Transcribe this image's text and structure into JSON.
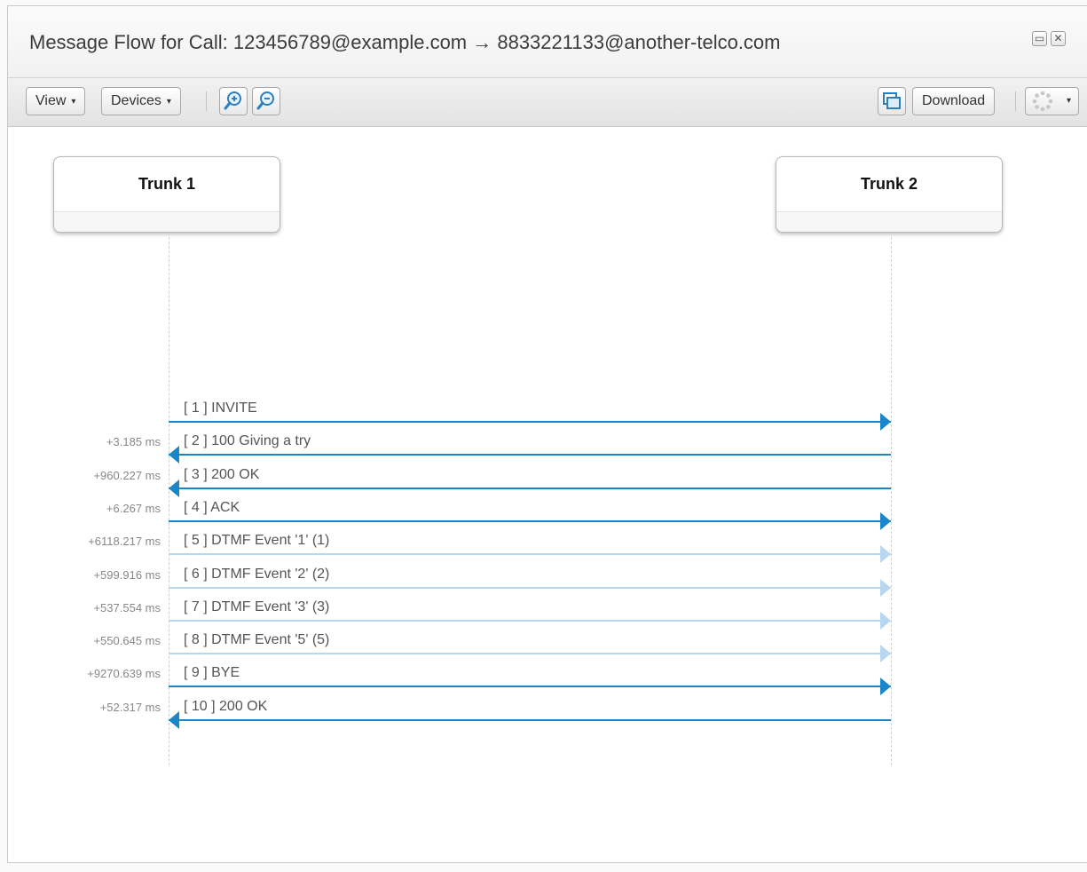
{
  "window": {
    "title": "Message Flow for Call: 123456789@example.com → 8833221133@another-telco.com",
    "maximize_icon": "▭",
    "close_icon": "✕"
  },
  "toolbar": {
    "view_label": "View",
    "devices_label": "Devices",
    "download_label": "Download",
    "caret": "▾"
  },
  "devices": [
    {
      "name": "Trunk 1"
    },
    {
      "name": "Trunk 2"
    }
  ],
  "messages": [
    {
      "label": "[ 1 ] INVITE",
      "delta": "",
      "direction": "right",
      "style": "normal"
    },
    {
      "label": "[ 2 ] 100 Giving a try",
      "delta": "+3.185 ms",
      "direction": "left",
      "style": "normal"
    },
    {
      "label": "[ 3 ] 200 OK",
      "delta": "+960.227 ms",
      "direction": "left",
      "style": "normal"
    },
    {
      "label": "[ 4 ] ACK",
      "delta": "+6.267 ms",
      "direction": "right",
      "style": "normal"
    },
    {
      "label": "[ 5 ] DTMF Event '1' (1)",
      "delta": "+6118.217 ms",
      "direction": "right",
      "style": "faded"
    },
    {
      "label": "[ 6 ] DTMF Event '2' (2)",
      "delta": "+599.916 ms",
      "direction": "right",
      "style": "faded"
    },
    {
      "label": "[ 7 ] DTMF Event '3' (3)",
      "delta": "+537.554 ms",
      "direction": "right",
      "style": "faded"
    },
    {
      "label": "[ 8 ] DTMF Event '5' (5)",
      "delta": "+550.645 ms",
      "direction": "right",
      "style": "faded"
    },
    {
      "label": "[ 9 ] BYE",
      "delta": "+9270.639 ms",
      "direction": "right",
      "style": "normal"
    },
    {
      "label": "[ 10 ] 200 OK",
      "delta": "+52.317 ms",
      "direction": "left",
      "style": "normal"
    }
  ],
  "colors": {
    "arrow": "#1a86c8",
    "arrow_faded": "#b8d7ef"
  }
}
